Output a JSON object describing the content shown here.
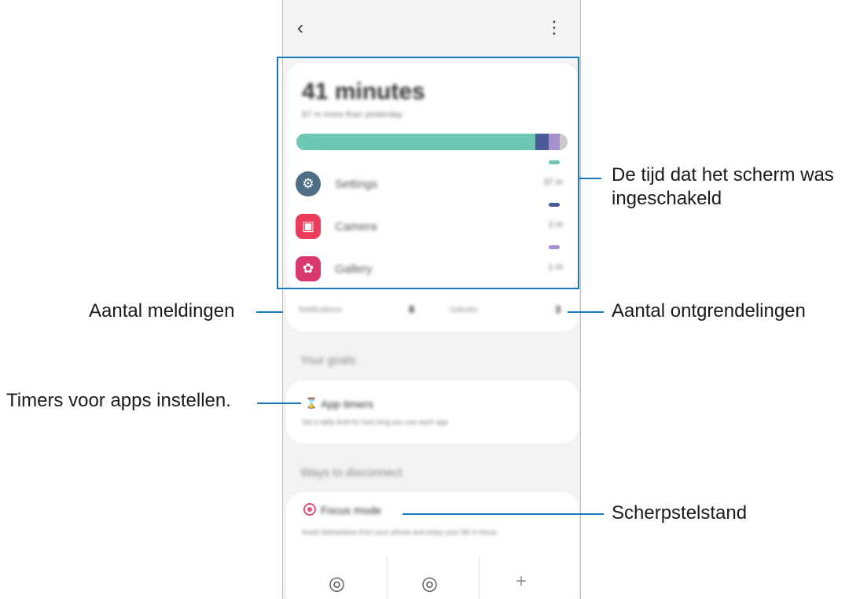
{
  "phone": {
    "back_icon": "chevron-left-icon",
    "more_icon": "more-vertical-icon",
    "screen_time": {
      "total": "41 minutes",
      "comparison": "87 m more than yesterday",
      "bar_colors": [
        "#6cc8b4",
        "#4a5a9a",
        "#a890cf",
        "#c9c9c9"
      ],
      "bar_fractions": [
        0.88,
        0.05,
        0.04,
        0.03
      ],
      "apps": [
        {
          "name": "Settings",
          "time": "37 m",
          "icon": "gear-icon",
          "color": "#4f6f86",
          "pill": "#6cc8b4"
        },
        {
          "name": "Camera",
          "time": "2 m",
          "icon": "camera-icon",
          "color": "#e83c5a",
          "pill": "#4a5a9a"
        },
        {
          "name": "Gallery",
          "time": "1 m",
          "icon": "flower-icon",
          "color": "#d8386c",
          "pill": "#a890cf"
        }
      ]
    },
    "stats": {
      "notifications_label": "Notifications",
      "notifications_value": "8",
      "unlocks_label": "Unlocks",
      "unlocks_value": "3"
    },
    "goals_title": "Your goals",
    "app_timers": {
      "title": "App timers",
      "description": "Set a daily limit for how long you use each app"
    },
    "disconnect_title": "Ways to disconnect",
    "focus_mode": {
      "title": "Focus mode",
      "description": "Avoid distractions from your phone and enjoy your life in focus."
    },
    "mode_tabs": [
      {
        "icon": "work-focus-icon"
      },
      {
        "icon": "study-focus-icon"
      },
      {
        "icon": "plus-icon"
      }
    ]
  },
  "callouts": {
    "screen_time": "De tijd dat het scherm was\ningeschakeld",
    "notifications": "Aantal meldingen",
    "unlocks": "Aantal ontgrendelingen",
    "app_timers": "Timers voor apps instellen.",
    "focus_mode": "Scherpstelstand"
  },
  "accent_color": "#1779b8"
}
